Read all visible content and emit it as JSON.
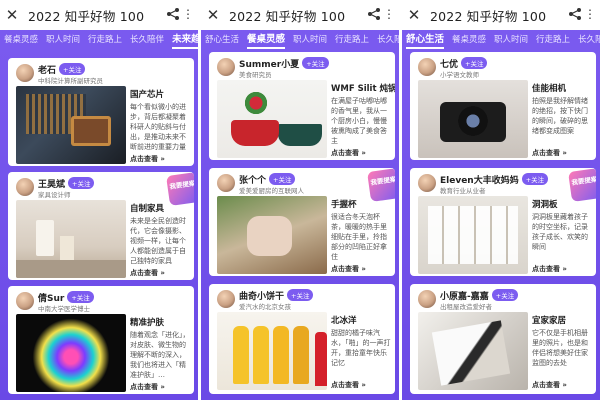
{
  "panels": [
    {
      "title": "2022 知乎好物 100",
      "tabs": [
        {
          "label": "餐桌灵感",
          "active": false
        },
        {
          "label": "职人时间",
          "active": false
        },
        {
          "label": "行走路上",
          "active": false
        },
        {
          "label": "长久陪伴",
          "active": false
        },
        {
          "label": "未来趋势",
          "active": true
        }
      ],
      "cards": [
        {
          "name": "老石",
          "follow": "+关注",
          "role": "中科院计算所副研究员",
          "title": "国产芯片",
          "desc": "每个看似微小的进步，背后都凝聚着科研人的贴斜与付出，是推动未来不断前进的重要力量",
          "more": "点击查看 »"
        },
        {
          "name": "王昊斌",
          "follow": "+关注",
          "role": "家具设计师",
          "title": "自制家具",
          "desc": "未来是全民创造时代，它会像摄影、视频一样，让每个人都能创造属于自己独特的家具",
          "more": "点击查看 »",
          "badge": "我要提案"
        },
        {
          "name": "倩Sur",
          "follow": "+关注",
          "role": "中南大学医学博士",
          "title": "精准护肤",
          "desc": "随着观念「进化」，对皮肤、微生物的理解不断的深入，我们也将进入「精准护肤」…",
          "more": "点击查看 »"
        }
      ]
    },
    {
      "title": "2022 知乎好物 100",
      "tabs": [
        {
          "label": "舒心生活",
          "active": false
        },
        {
          "label": "餐桌灵感",
          "active": true
        },
        {
          "label": "职人时间",
          "active": false
        },
        {
          "label": "行走路上",
          "active": false
        },
        {
          "label": "长久陪伴",
          "active": false
        }
      ],
      "cards": [
        {
          "name": "Summer小夏",
          "follow": "+关注",
          "role": "美食研究员",
          "title": "WMF Silit 炖锅",
          "desc": "在满屋子咕嘟咕嘟的香气里，我从一个厨房小白，慢慢被熏陶成了美食答主",
          "more": "点击查看 »"
        },
        {
          "name": "张个个",
          "follow": "+关注",
          "role": "爱美爱厨房的互联网人",
          "title": "手握杯",
          "desc": "很适合冬天泡杯茶，暖暖的热手里细贴在手里，拎指部分的凹陷正好拿住",
          "more": "点击查看 »",
          "badge": "我要提案"
        },
        {
          "name": "曲奇小饼干",
          "follow": "+关注",
          "role": "爱汽水的北京女孩",
          "title": "北冰洋",
          "desc": "甜甜的橘子味汽水，「啪」的一声打开，重拾童年快乐记忆",
          "more": "点击查看 »"
        }
      ]
    },
    {
      "title": "2022 知乎好物 100",
      "tabs": [
        {
          "label": "舒心生活",
          "active": true
        },
        {
          "label": "餐桌灵感",
          "active": false
        },
        {
          "label": "职人时间",
          "active": false
        },
        {
          "label": "行走路上",
          "active": false
        },
        {
          "label": "长久陪伴",
          "active": false
        }
      ],
      "cards": [
        {
          "name": "七优",
          "follow": "+关注",
          "role": "小学语文教师",
          "title": "佳能相机",
          "desc": "拍照是我纾解情绪的绝招，按下快门的瞬间，破碎的思绪都变成图案",
          "more": "点击查看 »"
        },
        {
          "name": "Eleven大丰收妈妈",
          "follow": "+关注",
          "role": "教育行业从业者",
          "title": "洞洞板",
          "desc": "洞洞板里藏着孩子的时空坐标，记录孩子成长、欢笑的瞬间",
          "more": "点击查看 »",
          "badge": "我要提案"
        },
        {
          "name": "小原嘉-嘉嘉",
          "follow": "+关注",
          "role": "出租屋改造爱好者",
          "title": "宜家家居",
          "desc": "它不仅是手机相册里的照片，也是和伴侣将想美好住家监图的去处",
          "more": "点击查看 »"
        }
      ]
    }
  ],
  "icons": {
    "close": "close-icon",
    "share": "share-icon",
    "more": "more-vertical-icon"
  },
  "colors": {
    "accent": "#7c5cf0",
    "badge": "#ff7ab6"
  }
}
